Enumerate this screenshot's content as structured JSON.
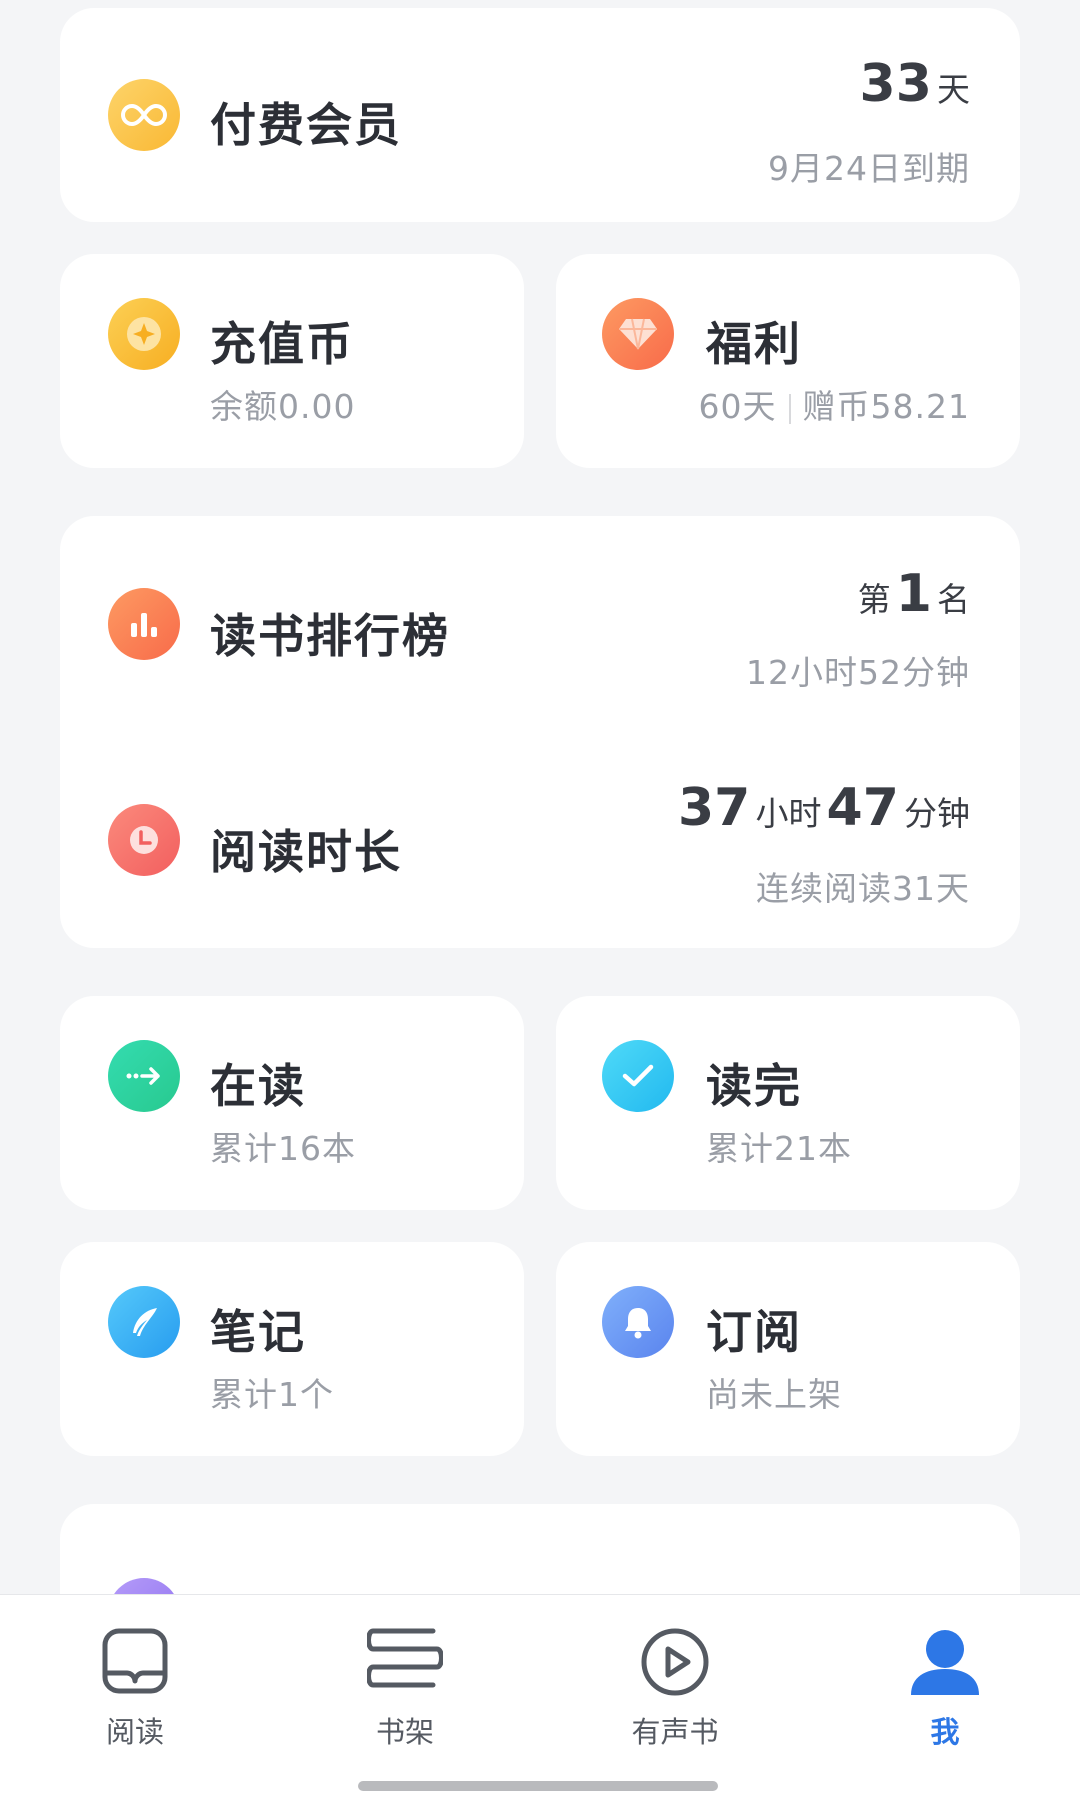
{
  "membership": {
    "title": "付费会员",
    "days_value": "33",
    "days_unit": "天",
    "expire_text": "9月24日到期",
    "icon": "infinity-icon",
    "icon_color": "#fbc34a"
  },
  "recharge": {
    "title": "充值币",
    "subtitle": "余额0.00",
    "icon": "coin-icon",
    "icon_color": "#f8b52b"
  },
  "welfare": {
    "title": "福利",
    "days_text": "60天",
    "bonus_text": "赠币58.21",
    "icon": "diamond-icon",
    "icon_color": "#fb7c4f"
  },
  "ranking": {
    "title": "读书排行榜",
    "rank_prefix": "第",
    "rank_value": "1",
    "rank_suffix": "名",
    "time_text": "12小时52分钟",
    "icon": "bar-chart-icon",
    "icon_color": "#fa6f4f"
  },
  "reading_time": {
    "title": "阅读时长",
    "hours_value": "37",
    "hours_unit": "小时",
    "minutes_value": "47",
    "minutes_unit": "分钟",
    "streak_text": "连续阅读31天",
    "icon": "clock-icon",
    "icon_color": "#f56a6a"
  },
  "reading": {
    "title": "在读",
    "subtitle": "累计16本",
    "icon": "arrow-right-icon",
    "icon_color": "#2fd3a0"
  },
  "finished": {
    "title": "读完",
    "subtitle": "累计21本",
    "icon": "check-icon",
    "icon_color": "#2ec8f3"
  },
  "notes": {
    "title": "笔记",
    "subtitle": "累计1个",
    "icon": "feather-icon",
    "icon_color": "#37b3f5"
  },
  "subscription": {
    "title": "订阅",
    "subtitle": "尚未上架",
    "icon": "bell-icon",
    "icon_color": "#5f8ff2"
  },
  "tabs": [
    {
      "label": "阅读",
      "icon": "book-icon",
      "active": false
    },
    {
      "label": "书架",
      "icon": "bookshelf-icon",
      "active": false
    },
    {
      "label": "有声书",
      "icon": "play-icon",
      "active": false
    },
    {
      "label": "我",
      "icon": "person-icon",
      "active": true
    }
  ],
  "colors": {
    "accent": "#2d77e6",
    "background": "#f4f5f7"
  }
}
